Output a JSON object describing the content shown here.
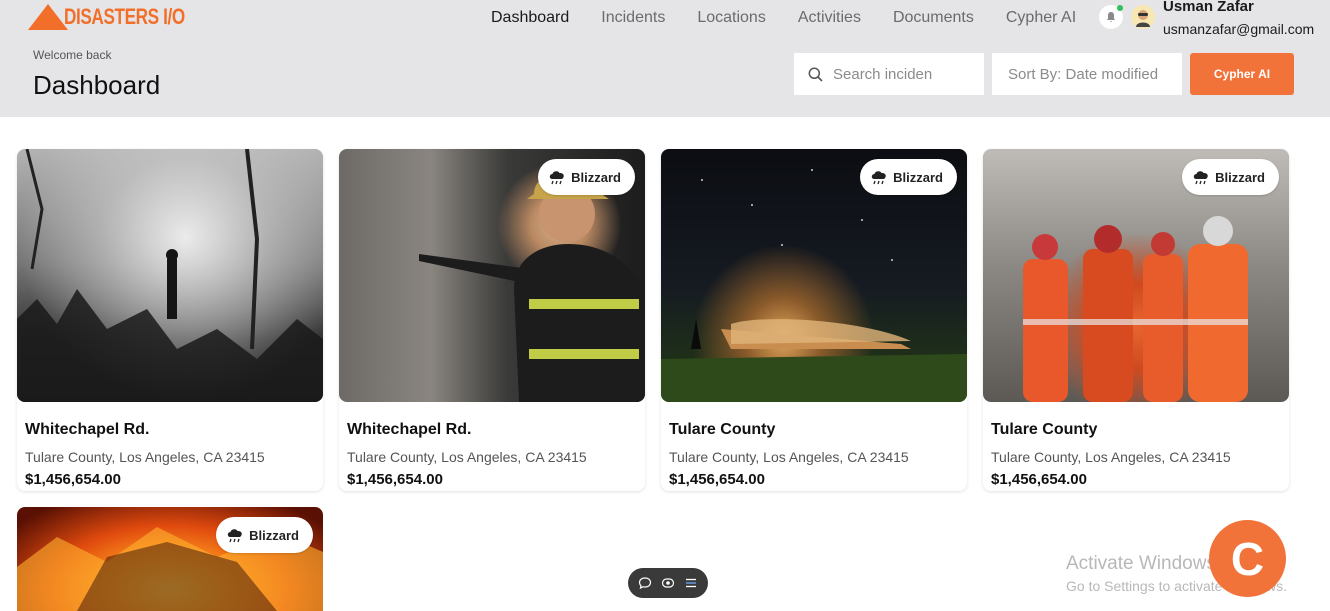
{
  "app": {
    "logo_text": "DISASTERS I/O",
    "brand_color": "#f2733a"
  },
  "nav": {
    "items": [
      {
        "label": "Dashboard",
        "active": true
      },
      {
        "label": "Incidents",
        "active": false
      },
      {
        "label": "Locations",
        "active": false
      },
      {
        "label": "Activities",
        "active": false
      },
      {
        "label": "Documents",
        "active": false
      },
      {
        "label": "Cypher AI",
        "active": false
      }
    ]
  },
  "user": {
    "name": "Usman Zafar",
    "email": "usmanzafar@gmail.com",
    "icons": [
      "bell-icon",
      "avatar"
    ]
  },
  "header": {
    "welcome": "Welcome back",
    "title": "Dashboard"
  },
  "toolbar": {
    "search_placeholder": "Search inciden",
    "sort_label": "Sort By: Date modified",
    "cypher_button": "Cypher AI"
  },
  "cards": [
    {
      "title": "Whitechapel Rd.",
      "address": "Tulare County, Los Angeles, CA 23415",
      "price": "$1,456,654.00",
      "tag": "",
      "image": "smoke-ruins"
    },
    {
      "title": "Whitechapel Rd.",
      "address": "Tulare County, Los Angeles, CA 23415",
      "price": "$1,456,654.00",
      "tag": "Blizzard",
      "image": "firefighter"
    },
    {
      "title": "Tulare County",
      "address": "Tulare County, Los Angeles, CA 23415",
      "price": "$1,456,654.00",
      "tag": "Blizzard",
      "image": "plane-wreck-night"
    },
    {
      "title": "Tulare County",
      "address": "Tulare County, Los Angeles, CA 23415",
      "price": "$1,456,654.00",
      "tag": "Blizzard",
      "image": "rescue-team"
    },
    {
      "title": "",
      "address": "",
      "price": "",
      "tag": "Blizzard",
      "image": "house-fire"
    }
  ],
  "windows_watermark": {
    "title": "Activate Windows",
    "subtitle": "Go to Settings to activate Windows."
  },
  "chat_widget": {
    "letter": "C"
  }
}
